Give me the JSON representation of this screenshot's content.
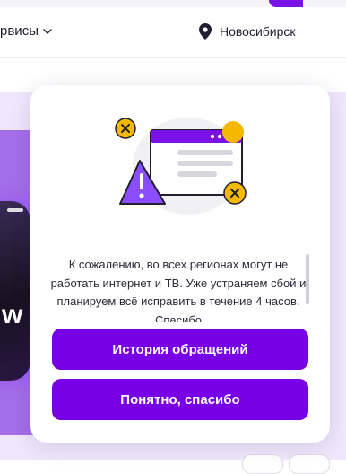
{
  "header": {
    "services_label": "рвисы",
    "city": "Новосибирск"
  },
  "background": {
    "banner_logo": "w"
  },
  "modal": {
    "message": "К сожалению, во всех регионах могут не работать интернет и ТВ. Уже устраняем сбой и планируем всё исправить в течение 4 часов. Спасибо",
    "history_button": "История обращений",
    "ok_button": "Понятно, спасибо"
  },
  "colors": {
    "accent": "#7700e6",
    "warning": "#f5b800"
  }
}
